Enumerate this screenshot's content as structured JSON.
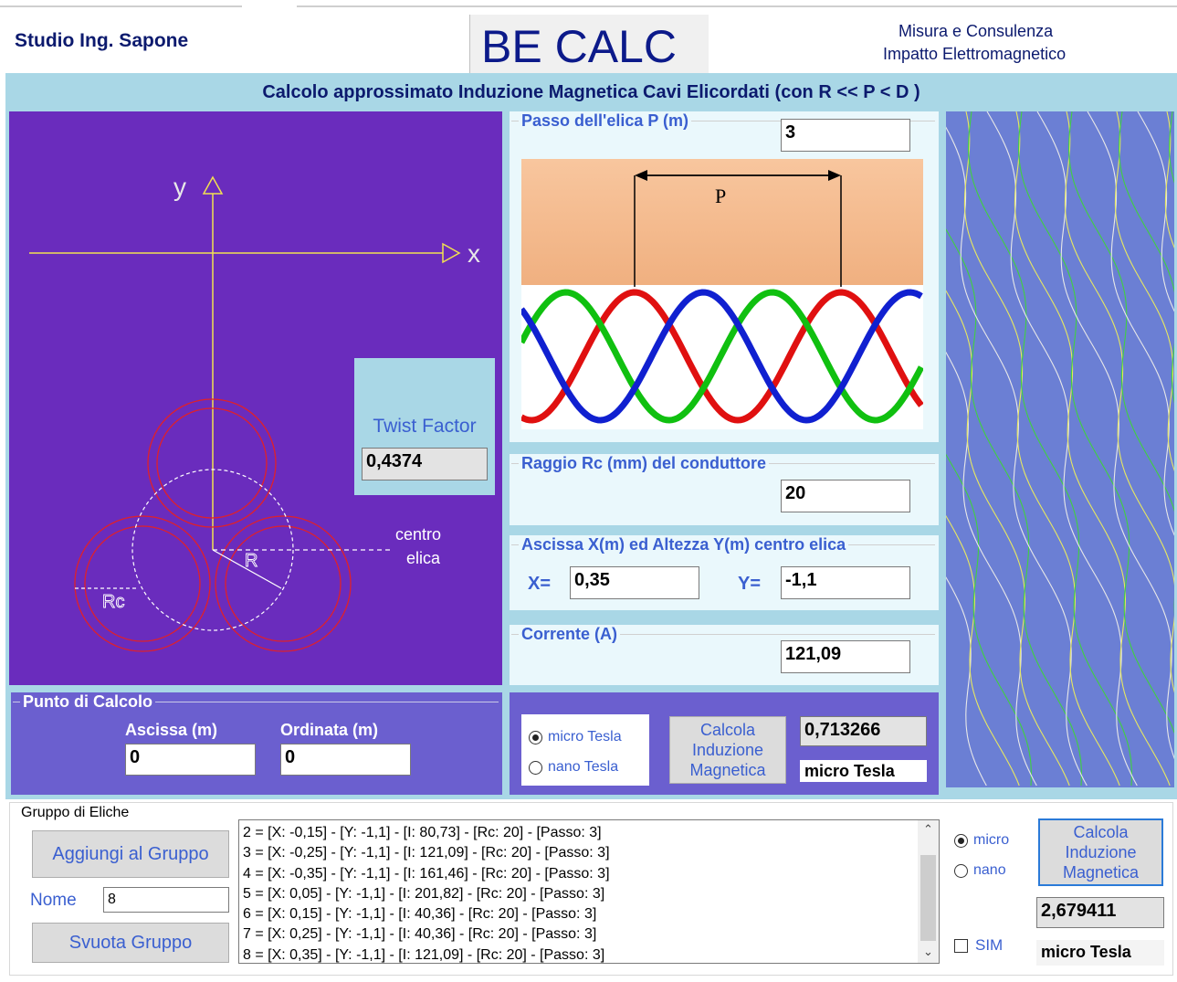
{
  "header": {
    "left_title": "Studio Ing. Sapone",
    "app_title": "BE CALC",
    "right_line1": "Misura e Consulenza",
    "right_line2": "Impatto Elettromagnetico"
  },
  "subtitle": "Calcolo approssimato Induzione Magnetica Cavi Elicordati (con R << P < D )",
  "diagram": {
    "y_label": "y",
    "x_label": "x",
    "r_label": "R",
    "rc_label": "Rc",
    "centro_line1": "centro",
    "centro_line2": "elica"
  },
  "twist": {
    "label": "Twist Factor",
    "value": "0,4374"
  },
  "passo": {
    "label": "Passo dell'elica P (m)",
    "value": "3",
    "p_label": "P"
  },
  "raggio": {
    "label": "Raggio Rc (mm) del conduttore",
    "value": "20"
  },
  "centro": {
    "label": "Ascissa X(m) ed Altezza Y(m) centro elica",
    "x_label": "X=",
    "x_value": "0,35",
    "y_label": "Y=",
    "y_value": "-1,1"
  },
  "corrente": {
    "label": "Corrente (A)",
    "value": "121,09"
  },
  "punto": {
    "label": "Punto di Calcolo",
    "ascissa_label": "Ascissa (m)",
    "ascissa_value": "0",
    "ordinata_label": "Ordinata (m)",
    "ordinata_value": "0"
  },
  "calc1": {
    "radio_micro": "micro Tesla",
    "radio_nano": "nano Tesla",
    "selected": "micro",
    "button_line1": "Calcola",
    "button_line2": "Induzione",
    "button_line3": "Magnetica",
    "result": "0,713266",
    "unit": "micro Tesla"
  },
  "gruppo": {
    "label": "Gruppo di Eliche",
    "add_button": "Aggiungi al Gruppo",
    "nome_label": "Nome",
    "nome_value": "8",
    "clear_button": "Svuota Gruppo",
    "list": [
      "2 = [X: -0,15] - [Y: -1,1] - [I: 80,73] - [Rc: 20] - [Passo: 3]",
      "3 = [X: -0,25] - [Y: -1,1] - [I: 121,09] - [Rc: 20] - [Passo: 3]",
      "4 = [X: -0,35] - [Y: -1,1] - [I: 161,46] - [Rc: 20] - [Passo: 3]",
      "5 = [X: 0,05] - [Y: -1,1] - [I: 201,82] - [Rc: 20] - [Passo: 3]",
      "6 = [X: 0,15] - [Y: -1,1] - [I: 40,36] - [Rc: 20] - [Passo: 3]",
      "7 = [X: 0,25] - [Y: -1,1] - [I: 40,36] - [Rc: 20] - [Passo: 3]",
      "8 = [X: 0,35] - [Y: -1,1] - [I: 121,09] - [Rc: 20] - [Passo: 3]"
    ]
  },
  "calc2": {
    "radio_micro": "micro",
    "radio_nano": "nano",
    "selected": "micro",
    "button_line1": "Calcola",
    "button_line2": "Induzione",
    "button_line3": "Magnetica",
    "result": "2,679411",
    "sim_label": "SIM",
    "unit": "micro Tesla"
  },
  "colors": {
    "light_blue": "#a9d7e6",
    "purple": "#6a2cbd",
    "panel_blue": "#6b5fcf",
    "accent_text": "#3a5fd0",
    "helix_bg": "#6b7fd4"
  }
}
